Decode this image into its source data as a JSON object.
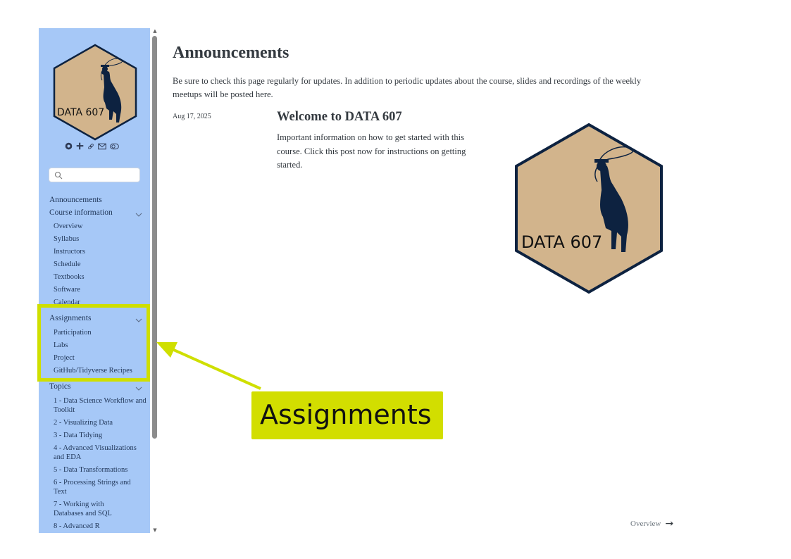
{
  "sidebar": {
    "logo_text": "DATA 607",
    "tools": [
      "github-icon",
      "slack-icon",
      "link-icon",
      "mail-icon",
      "toggle-icon"
    ],
    "search": {
      "placeholder": "",
      "value": ""
    },
    "items": [
      {
        "label": "Announcements"
      },
      {
        "label": "Course information",
        "children": [
          "Overview",
          "Syllabus",
          "Instructors",
          "Schedule",
          "Textbooks",
          "Software",
          "Calendar"
        ]
      },
      {
        "label": "Assignments",
        "children": [
          "Participation",
          "Labs",
          "Project",
          "GitHub/Tidyverse Recipes"
        ]
      },
      {
        "label": "Topics",
        "children": [
          "1 - Data Science Workflow and Toolkit",
          "2 - Visualizing Data",
          "3 - Data Tidying",
          "4 - Advanced Visualizations and EDA",
          "5 - Data Transformations",
          "6 - Processing Strings and Text",
          "7 - Working with Databases and SQL",
          "8 - Advanced R"
        ]
      }
    ]
  },
  "callout": {
    "label": "Assignments",
    "color": "#d2de00"
  },
  "main": {
    "title": "Announcements",
    "intro": "Be sure to check this page regularly for updates. In addition to periodic updates about the course, slides and recordings of the weekly meetups will be posted here.",
    "post": {
      "date": "Aug 17, 2025",
      "title": "Welcome to DATA 607",
      "body": "Important information on how to get started with this course. Click this post now for instructions on getting started.",
      "image_text": "DATA 607"
    },
    "next_link": "Overview"
  },
  "colors": {
    "sidebar_bg": "#a6c8f7",
    "highlight": "#cfdf00",
    "logo_fill": "#d2b48c",
    "logo_stroke": "#0d2240"
  }
}
